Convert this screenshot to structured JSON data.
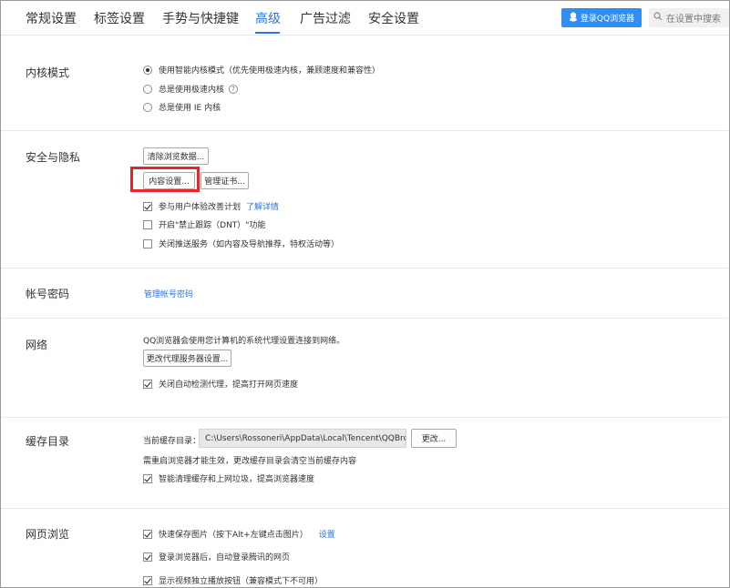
{
  "tabs": [
    {
      "label": "常规设置",
      "active": false
    },
    {
      "label": "标签设置",
      "active": false
    },
    {
      "label": "手势与快捷键",
      "active": false
    },
    {
      "label": "高级",
      "active": true
    },
    {
      "label": "广告过滤",
      "active": false
    },
    {
      "label": "安全设置",
      "active": false
    }
  ],
  "header": {
    "login_label": "登录QQ浏览器",
    "search_placeholder": "在设置中搜索"
  },
  "kernel": {
    "title": "内核模式",
    "options": [
      {
        "label": "使用智能内核模式（优先使用极速内核，兼顾速度和兼容性）",
        "selected": true
      },
      {
        "label": "总是使用极速内核",
        "selected": false
      },
      {
        "label": "总是使用 IE 内核",
        "selected": false
      }
    ]
  },
  "privacy": {
    "title": "安全与隐私",
    "clear_button": "清除浏览数据...",
    "content_button": "内容设置...",
    "cert_button": "管理证书...",
    "checks": [
      {
        "label": "参与用户体验改善计划",
        "checked": true
      },
      {
        "label": "开启\"禁止跟踪（DNT）\"功能",
        "checked": false
      },
      {
        "label": "关闭推送服务（如内容及导航推荐，特权活动等）",
        "checked": false
      }
    ],
    "learn_more": "了解详情"
  },
  "account": {
    "title": "帐号密码",
    "manage_link": "管理帐号密码"
  },
  "network": {
    "title": "网络",
    "description": "QQ浏览器会使用您计算机的系统代理设置连接到网络。",
    "proxy_button": "更改代理服务器设置...",
    "check": {
      "label": "关闭自动检测代理，提高打开网页速度",
      "checked": true
    }
  },
  "cache": {
    "title": "缓存目录",
    "current_label": "当前缓存目录：",
    "path": "C:\\Users\\Rossoneri\\AppData\\Local\\Tencent\\QQBrowser",
    "change_button": "更改...",
    "note": "需重启浏览器才能生效，更改缓存目录会清空当前缓存内容",
    "check": {
      "label": "智能清理缓存和上网垃圾，提高浏览器速度",
      "checked": true
    }
  },
  "browsing": {
    "title": "网页浏览",
    "checks": [
      {
        "label": "快速保存图片（按下Alt+左键点击图片）",
        "checked": true
      },
      {
        "label": "登录浏览器后，自动登录腾讯的网页",
        "checked": true
      },
      {
        "label": "显示视频独立播放按钮（兼容模式下不可用）",
        "checked": true
      }
    ],
    "settings_link": "设置"
  },
  "colors": {
    "accent": "#2f74d8",
    "login_bg": "#2e8ef5",
    "highlight": "#e8242b"
  }
}
